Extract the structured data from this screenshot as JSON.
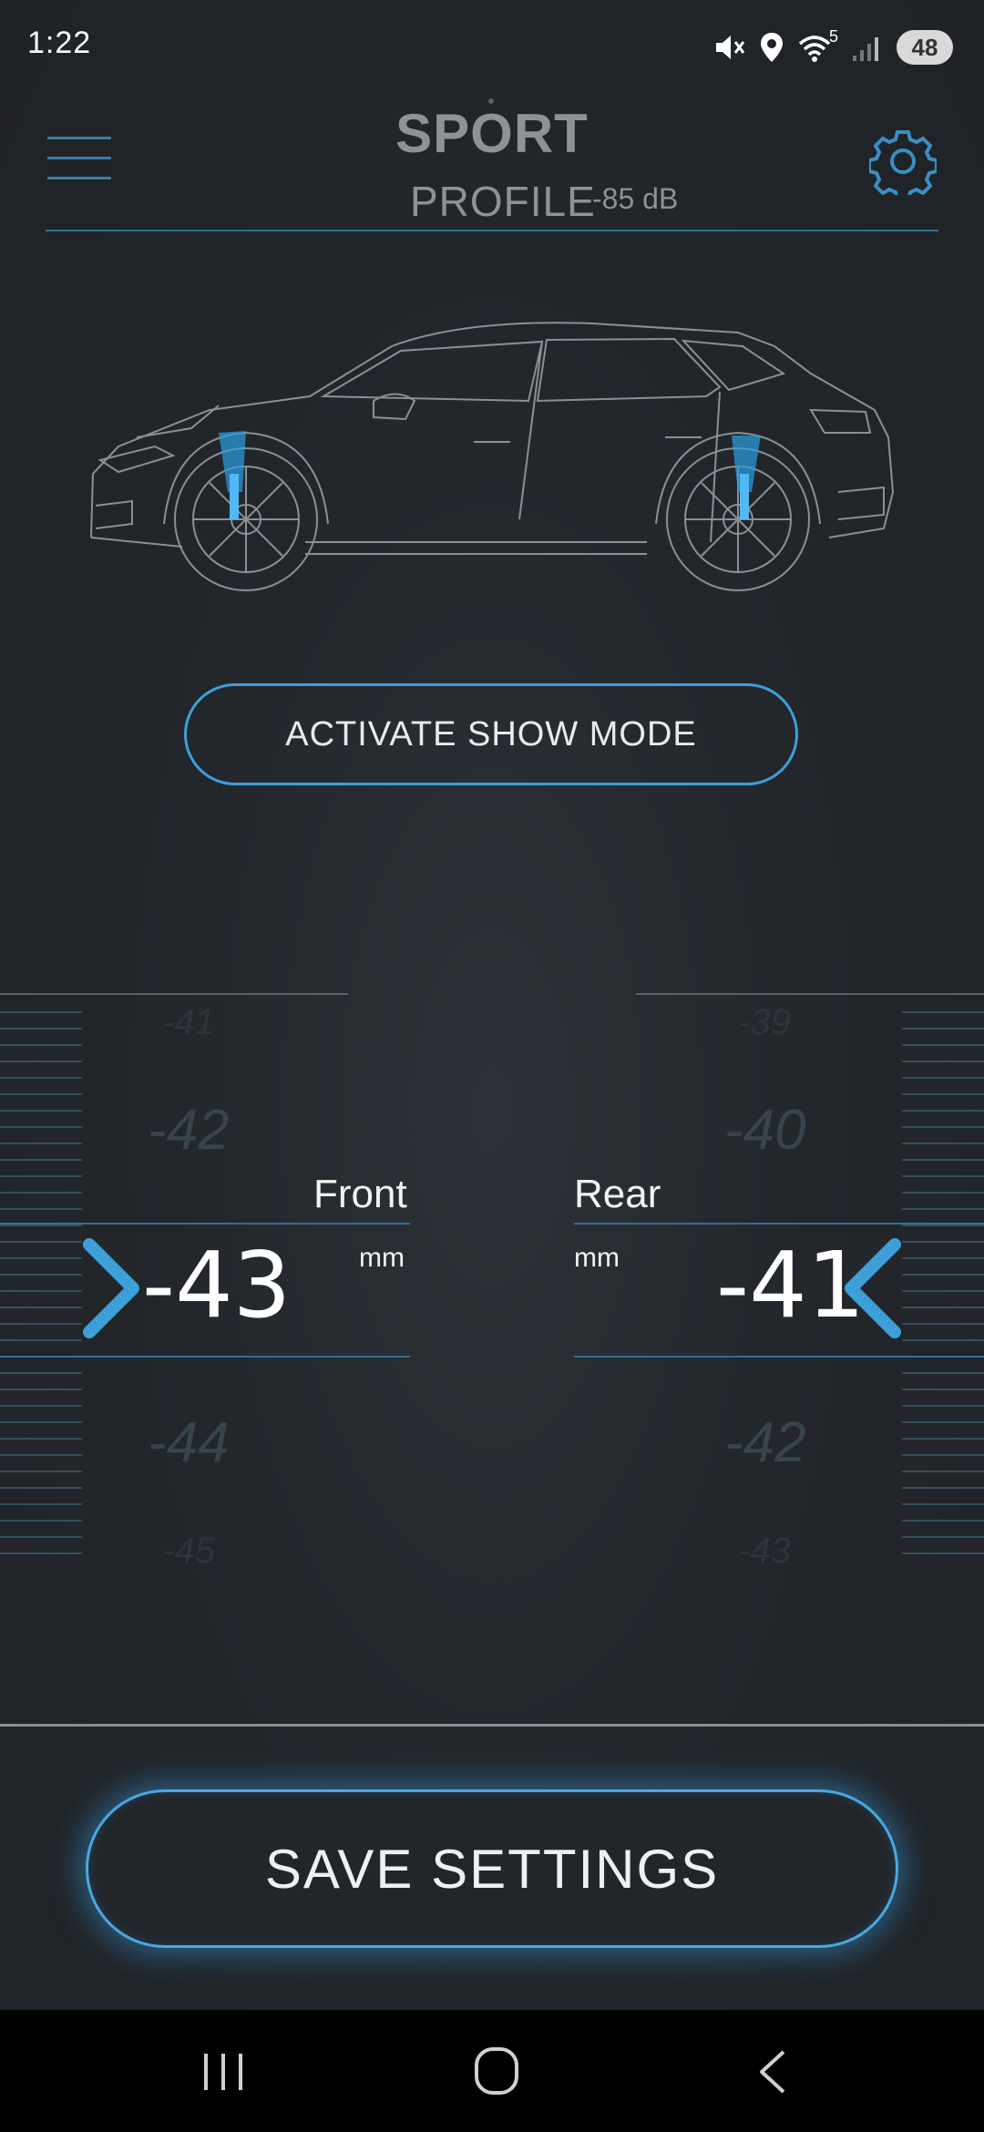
{
  "status_bar": {
    "time": "1:22",
    "wifi_badge": "5",
    "battery": "48"
  },
  "header": {
    "profile_name": "SPORT",
    "profile_label": "PROFILE",
    "profile_db": "-85 dB"
  },
  "show_mode_button": "ACTIVATE SHOW MODE",
  "front": {
    "label": "Front",
    "unit": "mm",
    "value": "-43",
    "ghost_above_far": "-41",
    "ghost_above": "-42",
    "ghost_below": "-44",
    "ghost_below_far": "-45"
  },
  "rear": {
    "label": "Rear",
    "unit": "mm",
    "value": "-41",
    "ghost_above_far": "-39",
    "ghost_above": "-40",
    "ghost_below": "-42",
    "ghost_below_far": "-43"
  },
  "save_button": "SAVE SETTINGS",
  "colors": {
    "accent": "#3d9fd8",
    "background": "#23272c",
    "header_line": "#2f6f96"
  },
  "icons": [
    "menu-icon",
    "gear-icon",
    "chevron-right-icon",
    "chevron-left-icon",
    "mute-icon",
    "location-icon",
    "wifi-icon",
    "signal-icon",
    "battery-icon",
    "recents-icon",
    "home-icon",
    "back-icon"
  ]
}
